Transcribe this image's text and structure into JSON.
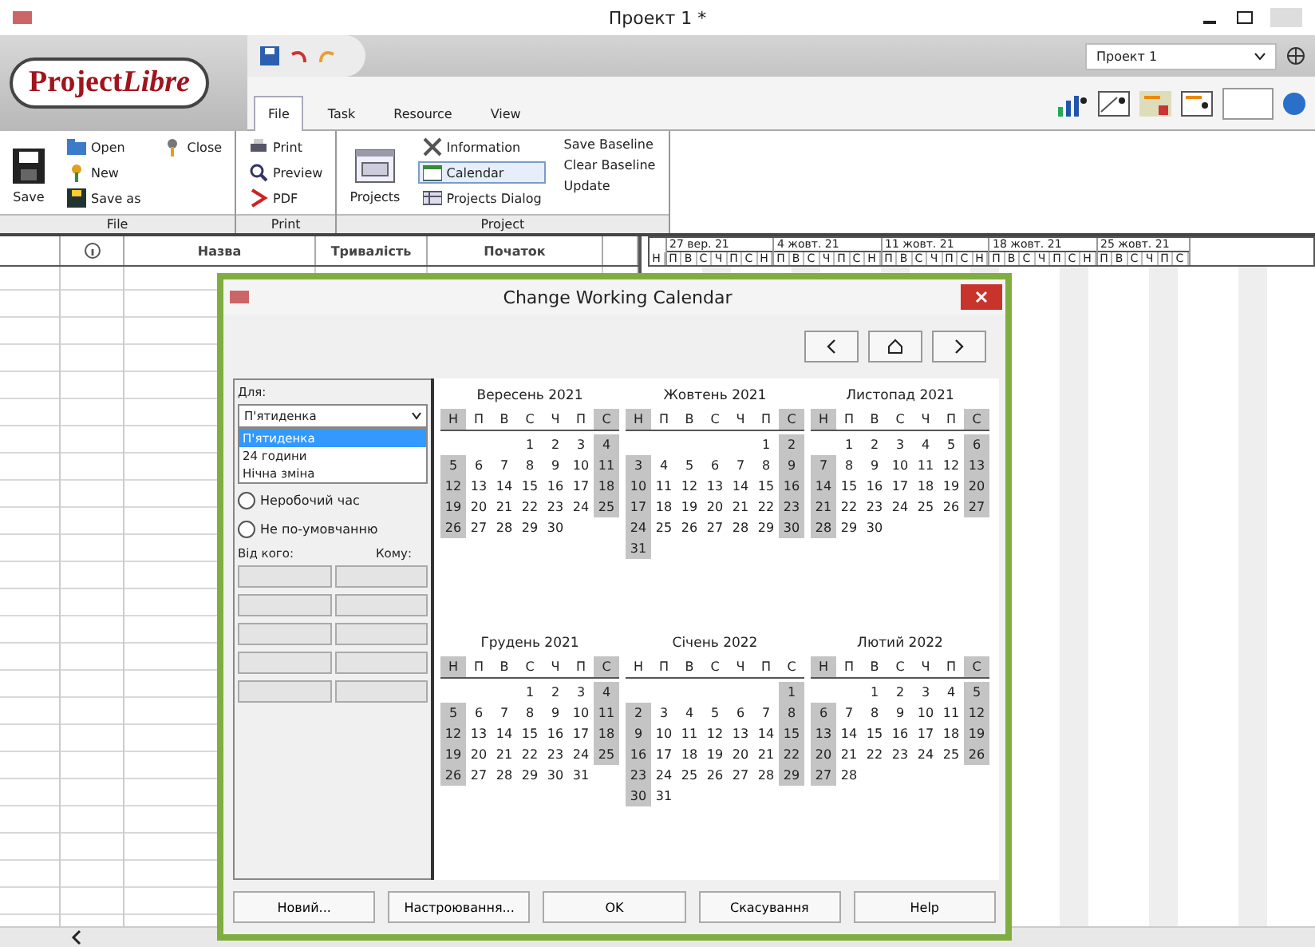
{
  "window": {
    "title": "Проект 1 *"
  },
  "logo": {
    "text": "Project",
    "italic_text": "Libre"
  },
  "project_selector": {
    "value": "Проект 1"
  },
  "tabs": [
    {
      "label": "File",
      "selected": true
    },
    {
      "label": "Task",
      "selected": false
    },
    {
      "label": "Resource",
      "selected": false
    },
    {
      "label": "View",
      "selected": false
    }
  ],
  "ribbon": {
    "groups": [
      {
        "label": "File",
        "columns": [
          [
            {
              "label": "Save",
              "kind": "large",
              "highlighted": false
            }
          ],
          [
            {
              "label": "Open",
              "kind": "small",
              "highlighted": false
            },
            {
              "label": "New",
              "kind": "small",
              "highlighted": false
            },
            {
              "label": "Save as",
              "kind": "small",
              "highlighted": false
            }
          ],
          [
            {
              "label": "Close",
              "kind": "small",
              "highlighted": false
            }
          ]
        ]
      },
      {
        "label": "Print",
        "columns": [
          [
            {
              "label": "Print",
              "kind": "small",
              "highlighted": false
            },
            {
              "label": "Preview",
              "kind": "small",
              "highlighted": false
            },
            {
              "label": "PDF",
              "kind": "small",
              "highlighted": false
            }
          ]
        ]
      },
      {
        "label": "Project",
        "columns": [
          [
            {
              "label": "Projects",
              "kind": "large",
              "highlighted": false
            }
          ],
          [
            {
              "label": "Information",
              "kind": "small",
              "highlighted": false
            },
            {
              "label": "Calendar",
              "kind": "small",
              "highlighted": true
            },
            {
              "label": "Projects Dialog",
              "kind": "small",
              "highlighted": false
            }
          ],
          [
            {
              "label": "Save Baseline",
              "kind": "text",
              "highlighted": false
            },
            {
              "label": "Clear Baseline",
              "kind": "text",
              "highlighted": false
            },
            {
              "label": "Update",
              "kind": "text",
              "highlighted": false
            }
          ]
        ]
      }
    ]
  },
  "table": {
    "columns": [
      {
        "kind": "blank"
      },
      {
        "kind": "info"
      },
      {
        "kind": "text",
        "label": "Назва"
      },
      {
        "kind": "text",
        "label": "Тривалість"
      },
      {
        "kind": "text",
        "label": "Початок"
      },
      {
        "kind": "blank"
      }
    ]
  },
  "gantt": {
    "lead_day": "Н",
    "weeks": [
      {
        "label": "27 вер. 21",
        "days": [
          "П",
          "В",
          "С",
          "Ч",
          "П",
          "С",
          "Н"
        ]
      },
      {
        "label": "4 жовт. 21",
        "days": [
          "П",
          "В",
          "С",
          "Ч",
          "П",
          "С",
          "Н"
        ]
      },
      {
        "label": "11 жовт. 21",
        "days": [
          "П",
          "В",
          "С",
          "Ч",
          "П",
          "С",
          "Н"
        ]
      },
      {
        "label": "18 жовт. 21",
        "days": [
          "П",
          "В",
          "С",
          "Ч",
          "П",
          "С",
          "Н"
        ]
      },
      {
        "label": "25 жовт. 21",
        "days": [
          "П",
          "В",
          "С",
          "Ч",
          "П",
          "С"
        ]
      }
    ]
  },
  "dialog": {
    "title": "Change Working Calendar",
    "for_label": "Для:",
    "calendar_select": {
      "value": "П'ятиденка",
      "expanded": true,
      "options": [
        {
          "label": "П'ятиденка",
          "selected": true
        },
        {
          "label": "24 години",
          "selected": false
        },
        {
          "label": "Нічна зміна",
          "selected": false
        }
      ]
    },
    "radios": [
      {
        "label": "Неробочий час",
        "selected": false
      },
      {
        "label": "Не по-умовчанню",
        "selected": false
      }
    ],
    "from_label": "Від кого:",
    "to_label": "Кому:",
    "months": [
      {
        "title": "Вересень 2021",
        "header_shaded": true,
        "weekdays": [
          {
            "label": "Н",
            "nonworking": true
          },
          {
            "label": "П",
            "nonworking": false
          },
          {
            "label": "В",
            "nonworking": false
          },
          {
            "label": "С",
            "nonworking": false
          },
          {
            "label": "Ч",
            "nonworking": false
          },
          {
            "label": "П",
            "nonworking": false
          },
          {
            "label": "С",
            "nonworking": true
          }
        ],
        "weeks": [
          [
            "1",
            "2",
            "3",
            "4"
          ],
          [
            "5",
            "6",
            "7",
            "8",
            "9",
            "10",
            "11"
          ],
          [
            "12",
            "13",
            "14",
            "15",
            "16",
            "17",
            "18"
          ],
          [
            "19",
            "20",
            "21",
            "22",
            "23",
            "24",
            "25"
          ],
          [
            "26",
            "27",
            "28",
            "29",
            "30"
          ]
        ]
      },
      {
        "title": "Жовтень 2021",
        "header_shaded": true,
        "weekdays": [
          {
            "label": "Н",
            "nonworking": true
          },
          {
            "label": "П",
            "nonworking": false
          },
          {
            "label": "В",
            "nonworking": false
          },
          {
            "label": "С",
            "nonworking": false
          },
          {
            "label": "Ч",
            "nonworking": false
          },
          {
            "label": "П",
            "nonworking": false
          },
          {
            "label": "С",
            "nonworking": true
          }
        ],
        "weeks": [
          [
            "1",
            "2"
          ],
          [
            "3",
            "4",
            "5",
            "6",
            "7",
            "8",
            "9"
          ],
          [
            "10",
            "11",
            "12",
            "13",
            "14",
            "15",
            "16"
          ],
          [
            "17",
            "18",
            "19",
            "20",
            "21",
            "22",
            "23"
          ],
          [
            "24",
            "25",
            "26",
            "27",
            "28",
            "29",
            "30"
          ],
          [
            "31"
          ]
        ]
      },
      {
        "title": "Листопад 2021",
        "header_shaded": true,
        "weekdays": [
          {
            "label": "Н",
            "nonworking": true
          },
          {
            "label": "П",
            "nonworking": false
          },
          {
            "label": "В",
            "nonworking": false
          },
          {
            "label": "С",
            "nonworking": false
          },
          {
            "label": "Ч",
            "nonworking": false
          },
          {
            "label": "П",
            "nonworking": false
          },
          {
            "label": "С",
            "nonworking": true
          }
        ],
        "weeks": [
          [
            "1",
            "2",
            "3",
            "4",
            "5",
            "6"
          ],
          [
            "7",
            "8",
            "9",
            "10",
            "11",
            "12",
            "13"
          ],
          [
            "14",
            "15",
            "16",
            "17",
            "18",
            "19",
            "20"
          ],
          [
            "21",
            "22",
            "23",
            "24",
            "25",
            "26",
            "27"
          ],
          [
            "28",
            "29",
            "30"
          ]
        ]
      },
      {
        "title": "Грудень 2021",
        "header_shaded": true,
        "weekdays": [
          {
            "label": "Н",
            "nonworking": true
          },
          {
            "label": "П",
            "nonworking": false
          },
          {
            "label": "В",
            "nonworking": false
          },
          {
            "label": "С",
            "nonworking": false
          },
          {
            "label": "Ч",
            "nonworking": false
          },
          {
            "label": "П",
            "nonworking": false
          },
          {
            "label": "С",
            "nonworking": true
          }
        ],
        "weeks": [
          [
            "1",
            "2",
            "3",
            "4"
          ],
          [
            "5",
            "6",
            "7",
            "8",
            "9",
            "10",
            "11"
          ],
          [
            "12",
            "13",
            "14",
            "15",
            "16",
            "17",
            "18"
          ],
          [
            "19",
            "20",
            "21",
            "22",
            "23",
            "24",
            "25"
          ],
          [
            "26",
            "27",
            "28",
            "29",
            "30",
            "31"
          ]
        ]
      },
      {
        "title": "Січень 2022",
        "header_shaded": false,
        "weekdays": [
          {
            "label": "Н",
            "nonworking": true
          },
          {
            "label": "П",
            "nonworking": false
          },
          {
            "label": "В",
            "nonworking": false
          },
          {
            "label": "С",
            "nonworking": false
          },
          {
            "label": "Ч",
            "nonworking": false
          },
          {
            "label": "П",
            "nonworking": false
          },
          {
            "label": "С",
            "nonworking": true
          }
        ],
        "weeks": [
          [
            "1"
          ],
          [
            "2",
            "3",
            "4",
            "5",
            "6",
            "7",
            "8"
          ],
          [
            "9",
            "10",
            "11",
            "12",
            "13",
            "14",
            "15"
          ],
          [
            "16",
            "17",
            "18",
            "19",
            "20",
            "21",
            "22"
          ],
          [
            "23",
            "24",
            "25",
            "26",
            "27",
            "28",
            "29"
          ],
          [
            "30",
            "31"
          ]
        ]
      },
      {
        "title": "Лютий 2022",
        "header_shaded": true,
        "weekdays": [
          {
            "label": "Н",
            "nonworking": true
          },
          {
            "label": "П",
            "nonworking": false
          },
          {
            "label": "В",
            "nonworking": false
          },
          {
            "label": "С",
            "nonworking": false
          },
          {
            "label": "Ч",
            "nonworking": false
          },
          {
            "label": "П",
            "nonworking": false
          },
          {
            "label": "С",
            "nonworking": true
          }
        ],
        "weeks": [
          [
            "1",
            "2",
            "3",
            "4",
            "5"
          ],
          [
            "6",
            "7",
            "8",
            "9",
            "10",
            "11",
            "12"
          ],
          [
            "13",
            "14",
            "15",
            "16",
            "17",
            "18",
            "19"
          ],
          [
            "20",
            "21",
            "22",
            "23",
            "24",
            "25",
            "26"
          ],
          [
            "27",
            "28"
          ]
        ]
      }
    ],
    "buttons": [
      "Новий...",
      "Настроювання...",
      "OK",
      "Скасування",
      "Help"
    ]
  }
}
